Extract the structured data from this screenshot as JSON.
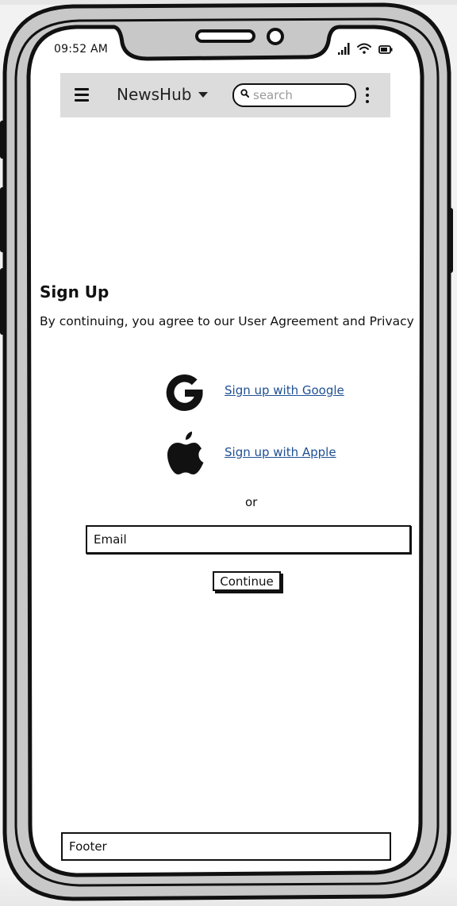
{
  "status_bar": {
    "time": "09:52 AM",
    "icons": [
      "signal-icon",
      "wifi-icon",
      "battery-icon"
    ]
  },
  "app_bar": {
    "menu_icon": "hamburger-icon",
    "title": "NewsHub",
    "dropdown_icon": "caret-down-icon",
    "search_placeholder": "search",
    "search_icon": "search-icon",
    "more_icon": "kebab-icon"
  },
  "signup": {
    "heading": "Sign Up",
    "agreement": "By continuing, you agree to our User Agreement and Privacy",
    "providers": [
      {
        "icon": "google-icon",
        "label": "Sign up with Google"
      },
      {
        "icon": "apple-icon",
        "label": "Sign up with Apple"
      }
    ],
    "separator": "or",
    "email_placeholder": "Email",
    "continue_label": "Continue"
  },
  "footer": {
    "label": "Footer"
  },
  "colors": {
    "app_bar_bg": "#dcdcdc",
    "link": "#1f4f94",
    "frame": "#c8c8c8",
    "ink": "#111111"
  }
}
